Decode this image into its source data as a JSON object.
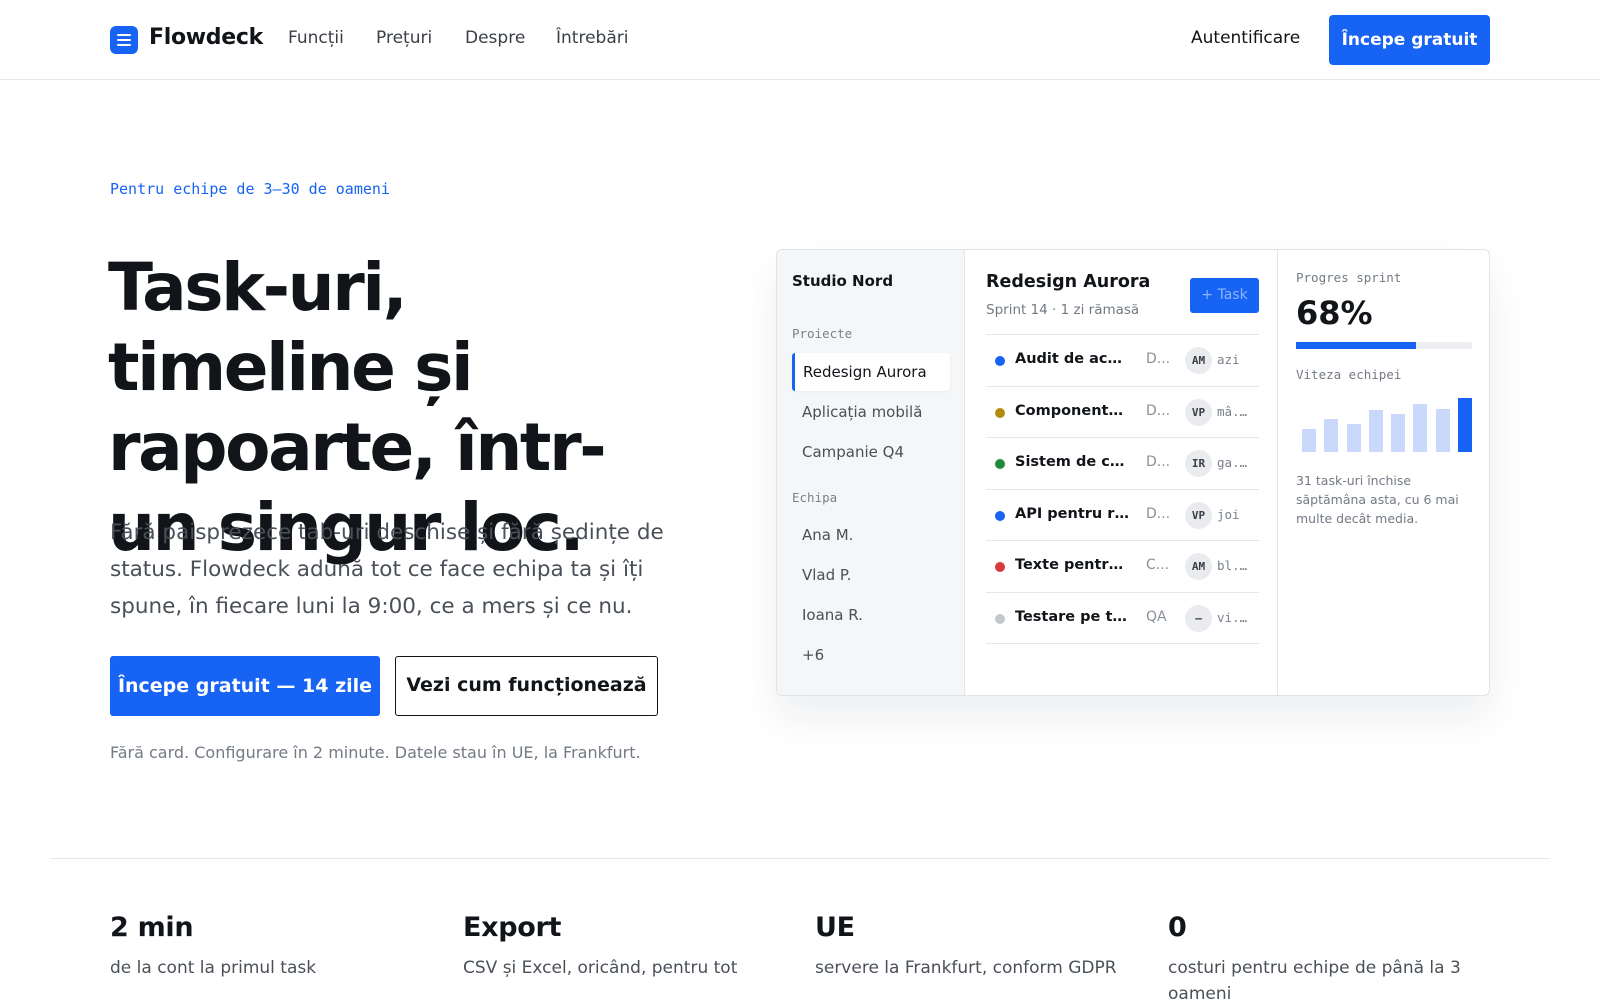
{
  "nav": {
    "brand": "Flowdeck",
    "links": [
      "Funcții",
      "Prețuri",
      "Despre",
      "Întrebări"
    ],
    "login": "Autentificare",
    "cta": "Începe gratuit"
  },
  "hero": {
    "eyebrow": "Pentru echipe de 3–30 de oameni",
    "headline": "Task-uri, timeline și rapoarte, într-un singur loc.",
    "lead": "Fără paisprezece tab-uri deschise și fără ședințe de status. Flowdeck adună tot ce face echipa ta și îți spune, în fiecare luni la 9:00, ce a mers și ce nu.",
    "primary_button": "Începe gratuit — 14 zile",
    "secondary_button": "Vezi cum funcționează",
    "fineprint": "Fără card. Configurare în 2 minute. Datele stau în UE, la Frankfurt."
  },
  "app": {
    "workspace": "Studio Nord",
    "projects_label": "Proiecte",
    "projects": [
      "Redesign Aurora",
      "Aplicația mobilă",
      "Campanie Q4"
    ],
    "active_project_index": 0,
    "team_label": "Echipa",
    "team": [
      "Ana M.",
      "Vlad P.",
      "Ioana R.",
      "+6"
    ],
    "project_title": "Redesign Aurora",
    "project_subtitle": "Sprint 14 · 1 zi rămasă",
    "add_task": "+ Task",
    "tasks": [
      {
        "name": "Audit de acce...",
        "tag": "D...",
        "assignee": "AM",
        "due": "azi",
        "color": "#1763f3"
      },
      {
        "name": "Componente ...",
        "tag": "D...",
        "assignee": "VP",
        "due": "mâ...",
        "color": "#b58a0c"
      },
      {
        "name": "Sistem de cul...",
        "tag": "D...",
        "assignee": "IR",
        "due": "ga...",
        "color": "#1e8a3c"
      },
      {
        "name": "API pentru ra...",
        "tag": "D...",
        "assignee": "VP",
        "due": "joi",
        "color": "#1763f3"
      },
      {
        "name": "Texte pentru ...",
        "tag": "C...",
        "assignee": "AM",
        "due": "bl...",
        "color": "#d83a3a"
      },
      {
        "name": "Testare pe tel...",
        "tag": "QA",
        "assignee": "—",
        "due": "vi...",
        "color": "#c4c7cc"
      }
    ],
    "progress_label": "Progres sprint",
    "progress_value": "68%",
    "progress_fraction": 0.68,
    "velocity_label": "Viteza echipei",
    "velocity": [
      0.42,
      0.62,
      0.52,
      0.78,
      0.7,
      0.88,
      0.8,
      1.0
    ],
    "velocity_note": "31 task-uri închise săptămâna asta, cu 6 mai multe decât media."
  },
  "stats": [
    {
      "value": "2 min",
      "label": "de la cont la primul task"
    },
    {
      "value": "Export",
      "label": "CSV și Excel, oricând, pentru tot"
    },
    {
      "value": "UE",
      "label": "servere la Frankfurt, conform GDPR"
    },
    {
      "value": "0",
      "label": "costuri pentru echipe de până la 3 oameni"
    }
  ],
  "colors": {
    "accent": "#1763f3",
    "text": "#111418",
    "muted": "#737a84"
  }
}
